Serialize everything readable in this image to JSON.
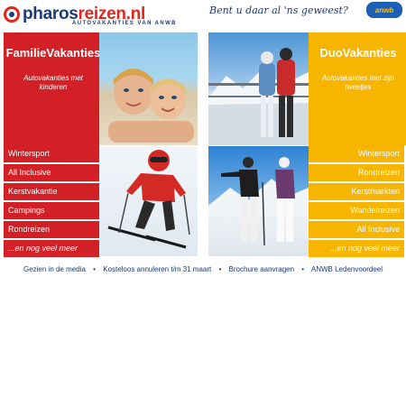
{
  "header": {
    "logo_main": "pharos",
    "logo_accent": "reizen.nl",
    "logo_sub": "AUTOVAKANTIES VAN ANWB",
    "tagline": "Bent u daar al 'ns geweest?",
    "anwb_badge": "anwb",
    "brand_blue": "#1b3a7a",
    "brand_red": "#e1271b"
  },
  "left_panel": {
    "title": "FamilieVakanties",
    "subtitle": "Autovakanties met kinderen",
    "color": "#d31f26",
    "links": [
      {
        "label": "Wintersport"
      },
      {
        "label": "All Inclusive"
      },
      {
        "label": "Kerstvakantie"
      },
      {
        "label": "Campings"
      },
      {
        "label": "Rondreizen"
      },
      {
        "label": "...en nog veel meer"
      }
    ]
  },
  "right_panel": {
    "title": "DuoVakanties",
    "subtitle": "Autovakanties met zijn tweetjes",
    "color": "#f7b500",
    "links": [
      {
        "label": "Wintersport"
      },
      {
        "label": "Rondreizen"
      },
      {
        "label": "Kerstmarkten"
      },
      {
        "label": "Wandelreizen"
      },
      {
        "label": "All Inclusive"
      },
      {
        "label": "...en nog veel meer"
      }
    ]
  },
  "footer": {
    "links": [
      {
        "label": "Gezien in de media"
      },
      {
        "label": "Kosteloos annuleren t/m 31 maart"
      },
      {
        "label": "Brochure aanvragen"
      },
      {
        "label": "ANWB Ledenvoordeel"
      }
    ],
    "separator": "•"
  }
}
